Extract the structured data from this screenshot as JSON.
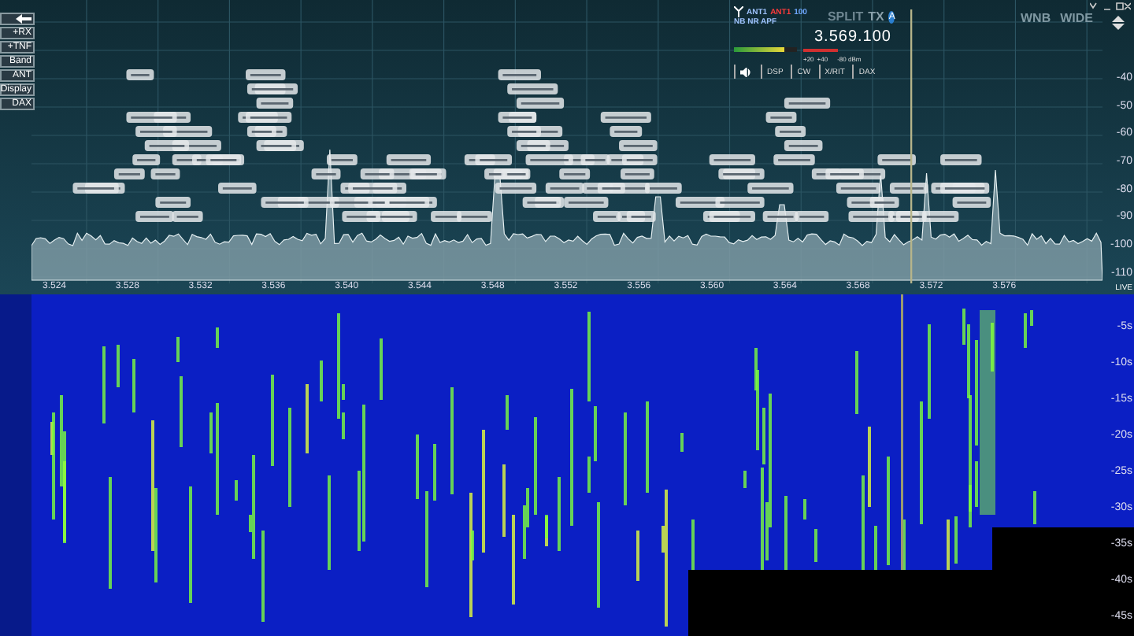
{
  "left_buttons": [
    "+RX",
    "+TNF",
    "Band",
    "ANT",
    "Display",
    "DAX"
  ],
  "slice": {
    "antennas": [
      {
        "label": "ANT1",
        "color": "#9fc4ff"
      },
      {
        "label": "ANT1",
        "color": "#ff3b3b"
      },
      {
        "label": "100",
        "color": "#6fa8ff"
      }
    ],
    "modes": "NB NR APF",
    "split": "SPLIT",
    "tx": "TX",
    "letter": "A",
    "frequency": "3.569.100",
    "meter": {
      "level": 0.8,
      "ticks": [
        "+20",
        "+40"
      ],
      "reading": "-80 dBm"
    },
    "buttons": [
      "DSP",
      "CW",
      "X/RIT",
      "DAX"
    ]
  },
  "panadapter_controls": [
    "WNB",
    "WIDE"
  ],
  "db_scale": [
    "-40",
    "-50",
    "-60",
    "-70",
    "-80",
    "-90",
    "-100",
    "-110"
  ],
  "freq_scale": [
    "3.524",
    "3.528",
    "3.532",
    "3.536",
    "3.540",
    "3.544",
    "3.548",
    "3.552",
    "3.556",
    "3.560",
    "3.564",
    "3.568",
    "3.572",
    "3.576"
  ],
  "waterfall": {
    "live": "LIVE",
    "time_scale": [
      "-5s",
      "-10s",
      "-15s",
      "-20s",
      "-25s",
      "-30s",
      "-35s",
      "-40s",
      "-45s"
    ]
  }
}
